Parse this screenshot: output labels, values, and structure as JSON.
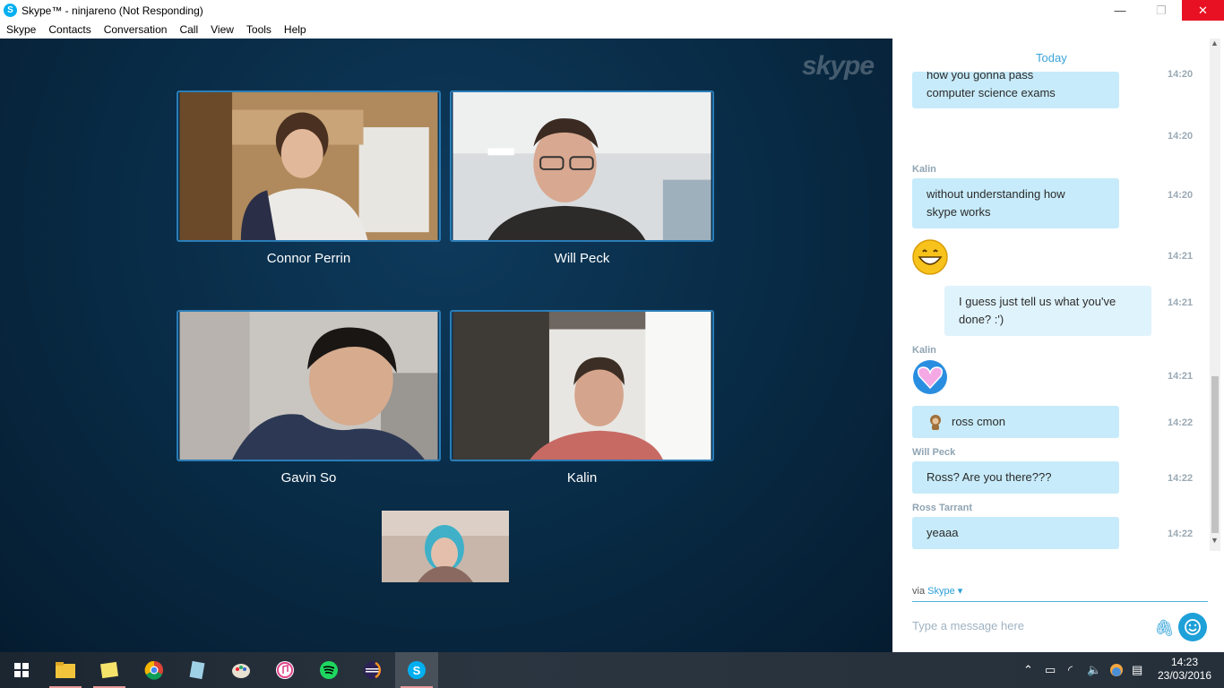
{
  "window": {
    "title": "Skype™ - ninjareno (Not Responding)",
    "minimize": "—",
    "maximize": "❐",
    "close": "✕"
  },
  "menu": [
    "Skype",
    "Contacts",
    "Conversation",
    "Call",
    "View",
    "Tools",
    "Help"
  ],
  "call": {
    "watermark": "skype",
    "participants": [
      {
        "name": "Connor Perrin"
      },
      {
        "name": "Will Peck"
      },
      {
        "name": "Gavin So"
      },
      {
        "name": "Kalin"
      }
    ]
  },
  "chat": {
    "date_divider": "Today",
    "messages": [
      {
        "text_line1": "how you gonna pass",
        "text_line2": "computer science exams",
        "time": "14:20"
      },
      {
        "time": "14:20"
      },
      {
        "sender": "Kalin",
        "text_line1": "without understanding how",
        "text_line2": "skype works",
        "time": "14:20"
      },
      {
        "emoji": "grin",
        "time": "14:21"
      },
      {
        "text_line1": "I guess just tell us what you've",
        "text_line2": "done? :')",
        "time": "14:21"
      },
      {
        "sender": "Kalin",
        "emoji": "heart",
        "time": "14:21"
      },
      {
        "text": "ross cmon",
        "time": "14:22"
      },
      {
        "sender": "Will Peck",
        "text": "Ross? Are you there???",
        "time": "14:22"
      },
      {
        "sender": "Ross Tarrant",
        "text": "yeaaa",
        "time": "14:22"
      }
    ],
    "via_label": "via",
    "via_link": "Skype ▾",
    "input_placeholder": "Type a message here"
  },
  "taskbar": {
    "clock_time": "14:23",
    "clock_date": "23/03/2016"
  },
  "colors": {
    "accent": "#00aff0",
    "bubble": "#c7ebfa",
    "close": "#e81123",
    "call_bg": "#082a44"
  }
}
